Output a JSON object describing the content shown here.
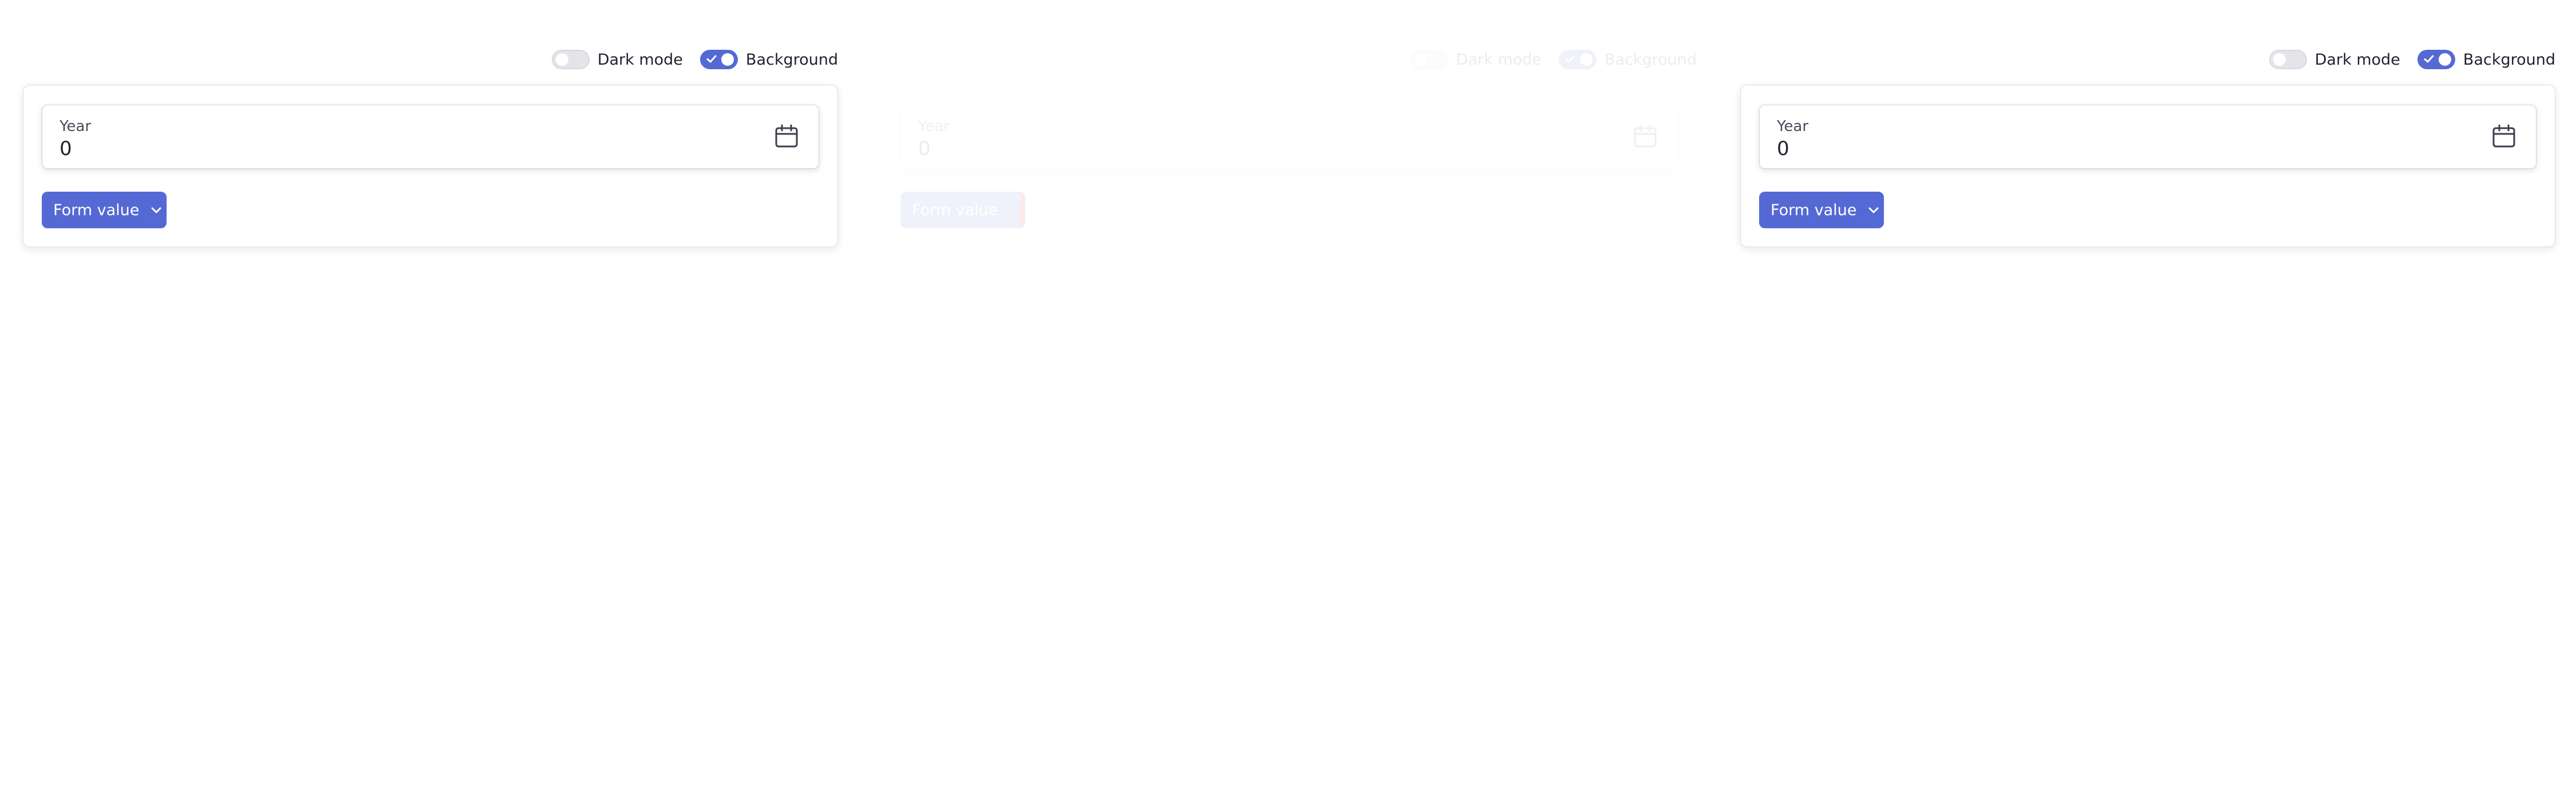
{
  "colors": {
    "accent": "#5469d4",
    "text": "#1f2130",
    "muted_text": "#4a4d5a",
    "switch_off": "#e4e5ea",
    "error_highlight": "#e00000"
  },
  "panels": [
    {
      "toggles": {
        "dark_mode": {
          "label": "Dark mode",
          "checked": false
        },
        "background": {
          "label": "Background",
          "checked": true
        }
      },
      "year_field": {
        "label": "Year",
        "value": "0",
        "icon": "calendar-icon"
      },
      "form_value_button": {
        "label": "Form value",
        "icon": "chevron-down-icon"
      }
    },
    {
      "toggles": {
        "dark_mode": {
          "label": "Dark mode",
          "checked": false
        },
        "background": {
          "label": "Background",
          "checked": true
        }
      },
      "year_field": {
        "label": "Year",
        "value": "0",
        "icon": "calendar-icon"
      },
      "form_value_button": {
        "label": "Form value",
        "icon": "chevron-down-icon"
      }
    },
    {
      "toggles": {
        "dark_mode": {
          "label": "Dark mode",
          "checked": false
        },
        "background": {
          "label": "Background",
          "checked": true
        }
      },
      "year_field": {
        "label": "Year",
        "value": "0",
        "icon": "calendar-icon"
      },
      "form_value_button": {
        "label": "Form value",
        "icon": "chevron-down-icon"
      }
    }
  ]
}
